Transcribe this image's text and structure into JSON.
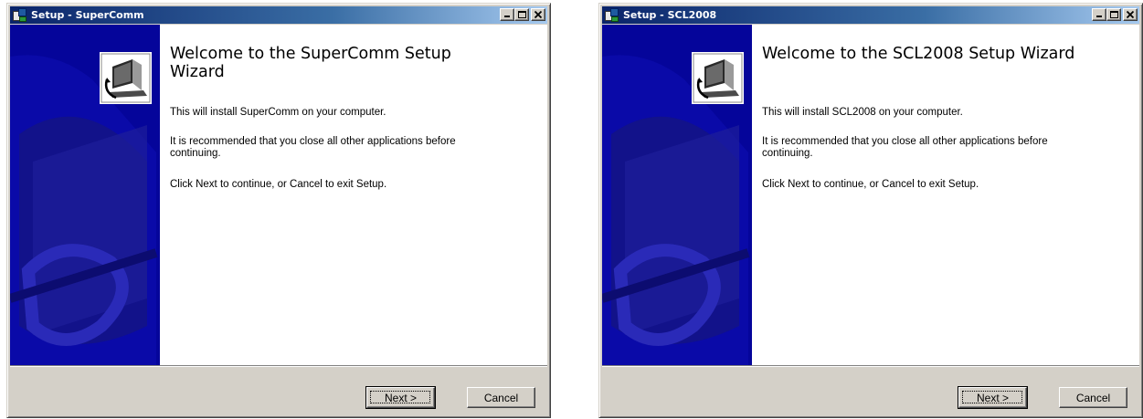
{
  "windows": [
    {
      "title": "Setup - SuperComm",
      "heading": "Welcome to the SuperComm Setup Wizard",
      "message1": "This will install SuperComm on your computer.",
      "message2": "It is recommended that you close all other applications before continuing.",
      "message3": "Click Next to continue, or Cancel to exit Setup.",
      "next_label": "Next >",
      "cancel_label": "Cancel"
    },
    {
      "title": "Setup - SCL2008",
      "heading": "Welcome to the SCL2008 Setup Wizard",
      "message1": "This will install SCL2008 on your computer.",
      "message2": "It is recommended that you close all other applications before continuing.",
      "message3": "Click Next to continue, or Cancel to exit Setup.",
      "next_label": "Next >",
      "cancel_label": "Cancel"
    }
  ],
  "icons": {
    "app": "setup-app-icon",
    "minimize": "minimize-icon",
    "maximize": "maximize-icon",
    "close": "close-icon",
    "banner": "computer-install-icon"
  },
  "colors": {
    "titlebar_start": "#0a246a",
    "titlebar_end": "#a6caf0",
    "banner_blue": "#05059a",
    "dialog_face": "#d4d0c8"
  }
}
